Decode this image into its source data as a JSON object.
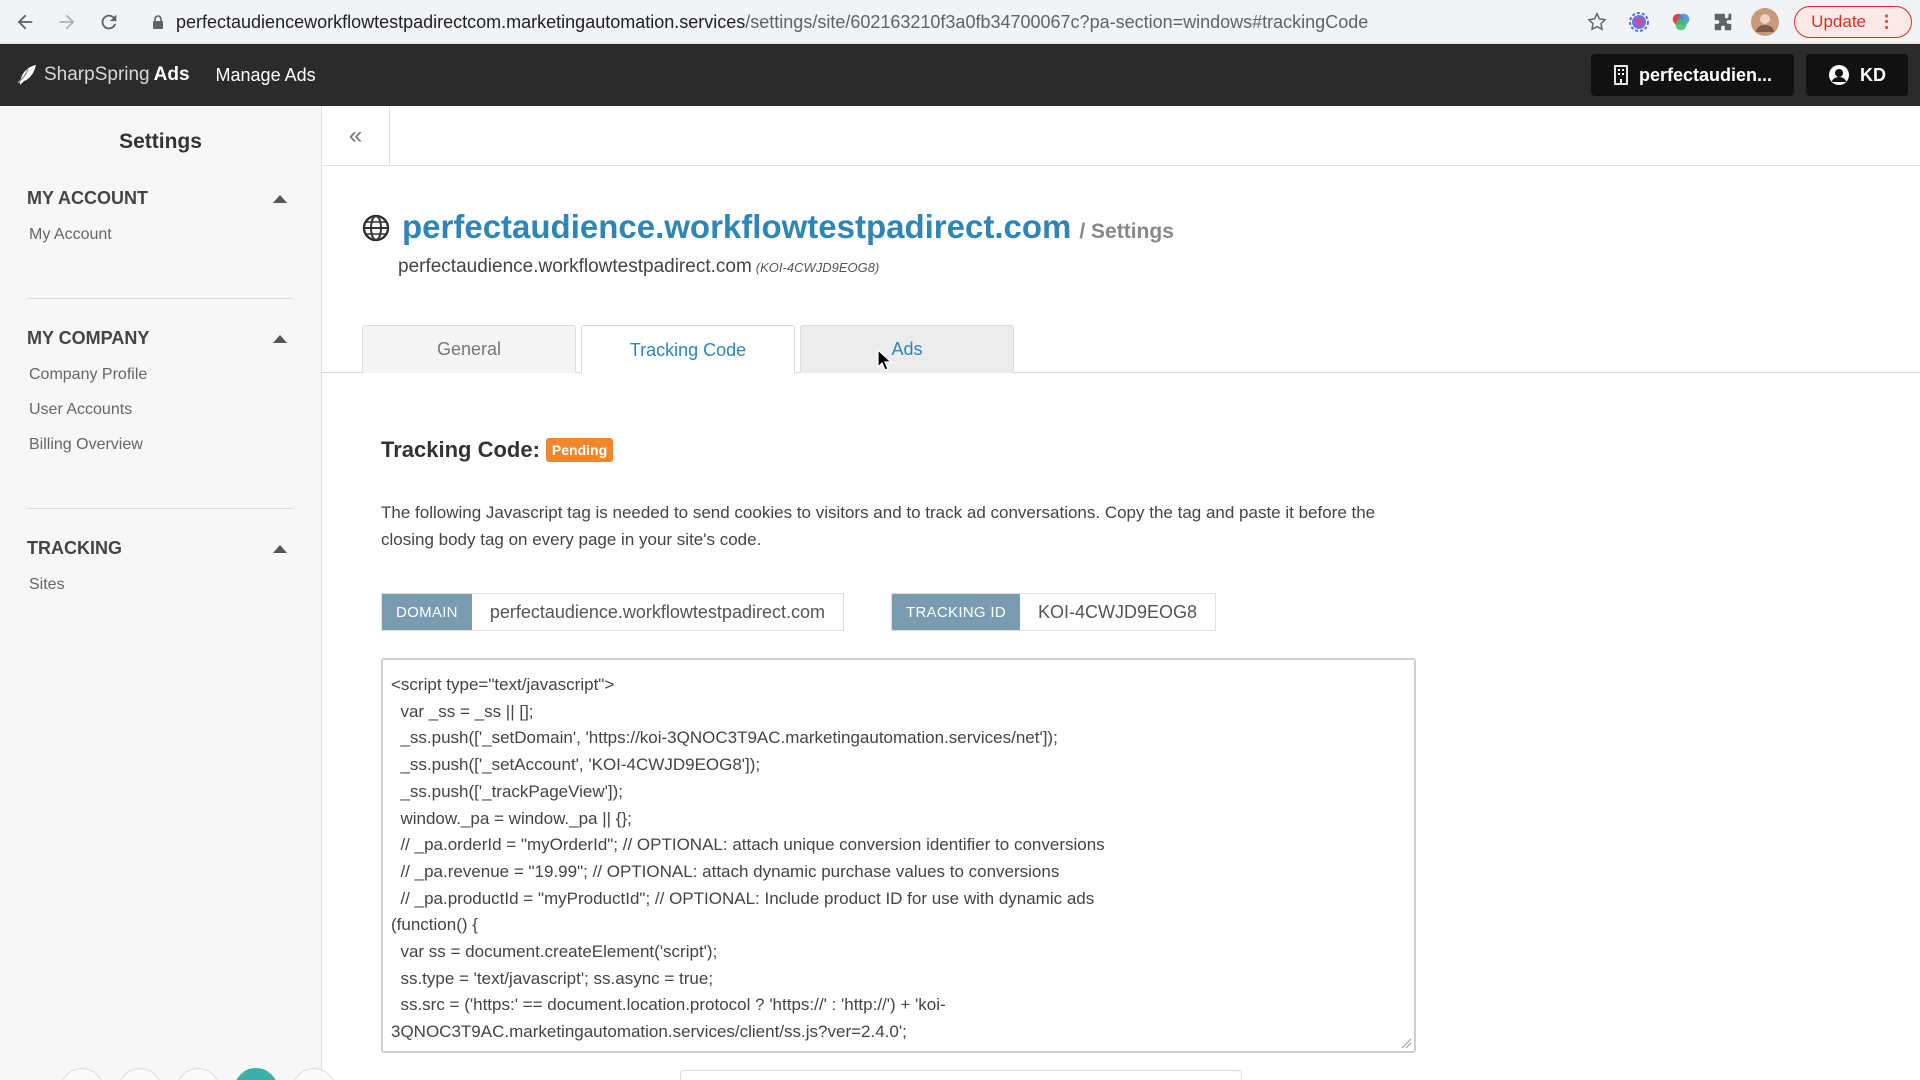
{
  "browser": {
    "url_host": "perfectaudienceworkflowtestpadirectcom.marketingautomation.services",
    "url_path": "/settings/site/602163210f3a0fb34700067c?pa-section=windows#trackingCode",
    "update_label": "Update",
    "menu_glyph": "⋮"
  },
  "appbar": {
    "brand_primary": "SharpSpring",
    "brand_secondary": "Ads",
    "manage_ads": "Manage Ads",
    "site_switch": "perfectaudien...",
    "user_initials": "KD"
  },
  "sidebar": {
    "title": "Settings",
    "sections": [
      {
        "heading": "MY ACCOUNT",
        "items": [
          "My Account"
        ]
      },
      {
        "heading": "MY COMPANY",
        "items": [
          "Company Profile",
          "User Accounts",
          "Billing Overview"
        ]
      },
      {
        "heading": "TRACKING",
        "items": [
          "Sites"
        ]
      }
    ]
  },
  "collapse_glyph": "«",
  "site": {
    "link": "perfectaudience.workflowtestpadirect.com",
    "crumb": "/ Settings",
    "subtitle": "perfectaudience.workflowtestpadirect.com",
    "subtitle_id": "(KOI-4CWJD9EOG8)"
  },
  "tabs": [
    {
      "label": "General",
      "state": "inactive"
    },
    {
      "label": "Tracking Code",
      "state": "active"
    },
    {
      "label": "Ads",
      "state": "hover"
    }
  ],
  "tracking": {
    "title": "Tracking Code:",
    "status": "Pending",
    "status_color": "#f0872d",
    "description": "The following Javascript tag is needed to send cookies to visitors and to track ad conversations. Copy the tag and paste it before the closing body tag on every page in your site's code.",
    "domain_label": "DOMAIN",
    "domain_value": "perfectaudience.workflowtestpadirect.com",
    "tracking_id_label": "TRACKING ID",
    "tracking_id_value": "KOI-4CWJD9EOG8",
    "code_lines": [
      "<script type=\"text/javascript\">",
      "  var _ss = _ss || [];",
      "  _ss.push(['_setDomain', 'https://koi-3QNOC3T9AC.marketingautomation.services/net']);",
      "  _ss.push(['_setAccount', 'KOI-4CWJD9EOG8']);",
      "  _ss.push(['_trackPageView']);",
      "  window._pa = window._pa || {};",
      "  // _pa.orderId = \"myOrderId\"; // OPTIONAL: attach unique conversion identifier to conversions",
      "  // _pa.revenue = \"19.99\"; // OPTIONAL: attach dynamic purchase values to conversions",
      "  // _pa.productId = \"myProductId\"; // OPTIONAL: Include product ID for use with dynamic ads",
      "(function() {",
      "  var ss = document.createElement('script');",
      "  ss.type = 'text/javascript'; ss.async = true;",
      "  ss.src = ('https:' == document.location.protocol ? 'https://' : 'http://') + 'koi-",
      "3QNOC3T9AC.marketingautomation.services/client/ss.js?ver=2.4.0';"
    ]
  },
  "colors": {
    "accent": "#2e86b6",
    "appbar": "#2b2b2b",
    "field_label": "#7b9bb1"
  }
}
